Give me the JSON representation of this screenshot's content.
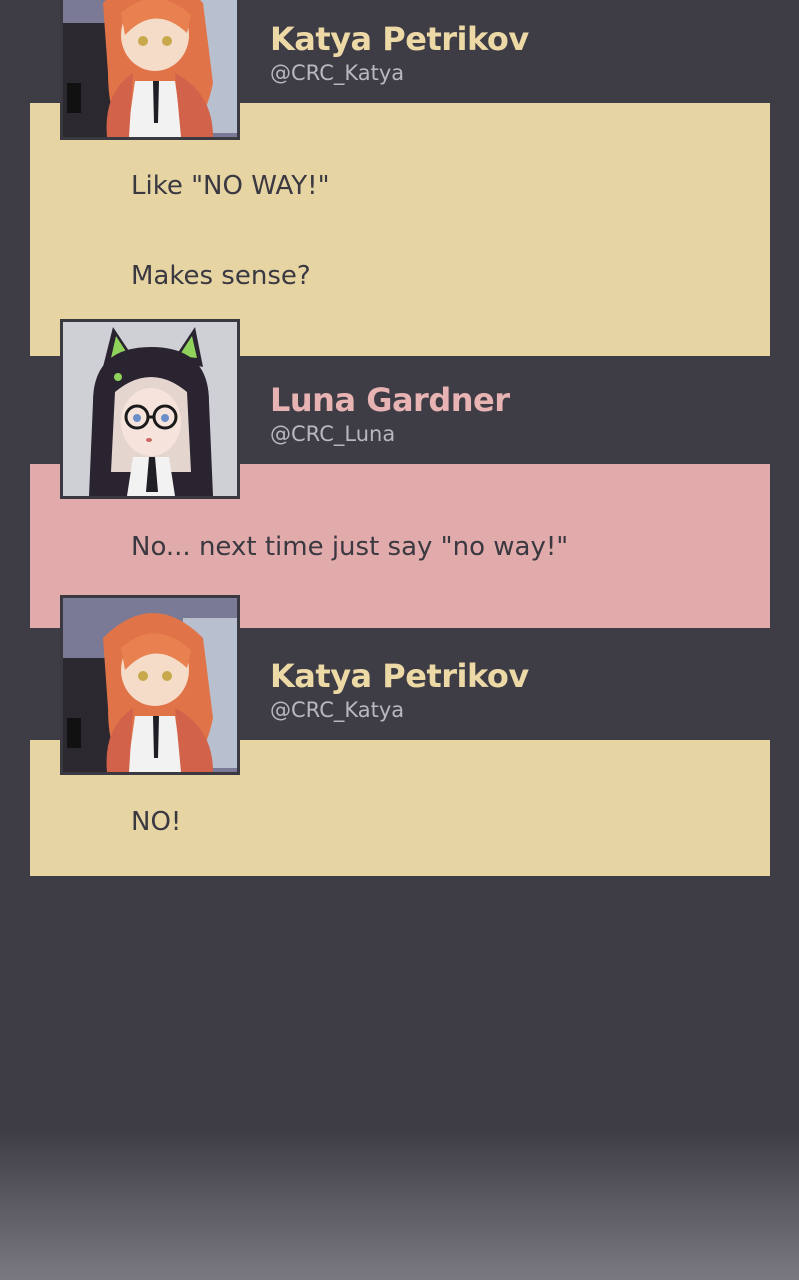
{
  "colors": {
    "background": "#3e3c45",
    "katya_bubble": "#e6d4a3",
    "luna_bubble": "#e2abab",
    "katya_name": "#ecd9a6",
    "luna_name": "#e8b3b3"
  },
  "messages": [
    {
      "name": "Katya Petrikov",
      "handle": "@CRC_Katya",
      "avatar": "katya-avatar",
      "lines": [
        "Like \"NO WAY!\"",
        "Makes sense?"
      ]
    },
    {
      "name": "Luna Gardner",
      "handle": "@CRC_Luna",
      "avatar": "luna-avatar",
      "lines": [
        "No... next time just say \"no way!\""
      ]
    },
    {
      "name": "Katya Petrikov",
      "handle": "@CRC_Katya",
      "avatar": "katya-avatar",
      "lines": [
        "NO!"
      ]
    }
  ]
}
